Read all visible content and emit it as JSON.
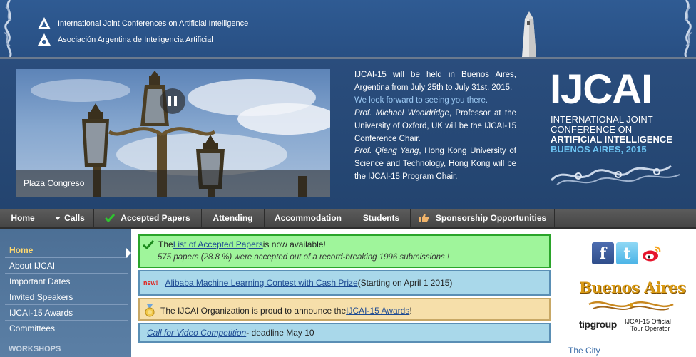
{
  "header": {
    "org1": "International Joint Conferences on Artificial Intelligence",
    "org2": "Asociación Argentina de Inteligencia Artificial"
  },
  "slideshow": {
    "caption": "Plaza Congreso"
  },
  "intro": {
    "p1": "IJCAI-15 will be held in Buenos Aires, Argentina from July 25th to July 31st, 2015.",
    "p2": "We look forward to seeing you there.",
    "p3_name": "Prof. Michael Wooldridge",
    "p3_rest": ", Professor at the University of Oxford, UK will be the IJCAI-15 Conference Chair.",
    "p4_name": "Prof. Qiang Yang",
    "p4_rest": ", Hong Kong University of Science and Technology, Hong Kong will be the IJCAI-15 Program Chair."
  },
  "logo": {
    "big": "IJCAI",
    "line1": "INTERNATIONAL JOINT",
    "line2": "CONFERENCE ON",
    "line3": "ARTIFICIAL INTELLIGENCE",
    "line4": "BUENOS AIRES, 2015"
  },
  "nav": {
    "home": "Home",
    "calls": "Calls",
    "accepted": "Accepted Papers",
    "attending": "Attending",
    "accommodation": "Accommodation",
    "students": "Students",
    "sponsorship": "Sponsorship Opportunities"
  },
  "sidebar": {
    "items": [
      {
        "label": "Home"
      },
      {
        "label": "About IJCAI"
      },
      {
        "label": "Important Dates"
      },
      {
        "label": "Invited Speakers"
      },
      {
        "label": "IJCAI-15 Awards"
      },
      {
        "label": "Committees"
      }
    ],
    "section": "WORKSHOPS"
  },
  "news": {
    "accepted": {
      "pre": "The ",
      "link": "List of Accepted Papers",
      "post": " is now available!",
      "sub": "575 papers (28.8 %) were accepted out of a record-breaking 1996 submissions !"
    },
    "alibaba": {
      "badge": "new!",
      "link": "Alibaba Machine Learning Contest with Cash Prize",
      "post": " (Starting on April 1 2015)"
    },
    "awards": {
      "pre": "The IJCAI Organization is proud to announce the ",
      "link": "IJCAI-15 Awards",
      "post": "!"
    },
    "video": {
      "link": "Call for Video Competition",
      "post": " - deadline May 10"
    }
  },
  "right": {
    "buenos_aires": "Buenos Aires",
    "tip_logo": "tipgroup",
    "tip_line1": "IJCAI-15 Official",
    "tip_line2": "Tour Operator",
    "city": "The City"
  },
  "colors": {
    "header_blue": "#2f5b93",
    "nav_gray": "#4f4f4f",
    "sidebar_blue": "#547799",
    "active_gold": "#ffd86e",
    "green_box": "#9ff59b",
    "blue_box": "#a9d8ea",
    "yellow_box": "#f6dfaa"
  }
}
